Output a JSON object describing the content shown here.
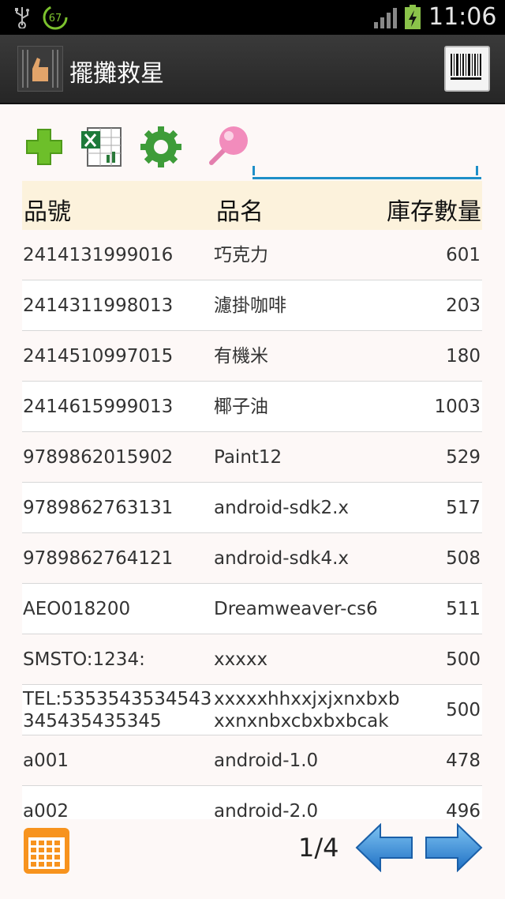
{
  "status": {
    "clock": "11:06",
    "badge": "67"
  },
  "app": {
    "title": "擺攤救星"
  },
  "search": {
    "value": "",
    "placeholder": ""
  },
  "table": {
    "headers": [
      "品號",
      "品名",
      "庫存數量"
    ],
    "rows": [
      {
        "id": "2414131999016",
        "name": "巧克力",
        "qty": "601"
      },
      {
        "id": "2414311998013",
        "name": "濾掛咖啡",
        "qty": "203"
      },
      {
        "id": "2414510997015",
        "name": "有機米",
        "qty": "180"
      },
      {
        "id": "2414615999013",
        "name": "椰子油",
        "qty": "1003"
      },
      {
        "id": "9789862015902",
        "name": "Paint12",
        "qty": "529"
      },
      {
        "id": "9789862763131",
        "name": "android-sdk2.x",
        "qty": "517"
      },
      {
        "id": "9789862764121",
        "name": "android-sdk4.x",
        "qty": "508"
      },
      {
        "id": "AEO018200",
        "name": "Dreamweaver-cs6",
        "qty": "511"
      },
      {
        "id": "SMSTO:1234:",
        "name": "xxxxx",
        "qty": "500"
      },
      {
        "id": "TEL:5353543534543\n345435435345",
        "name": "xxxxxhhxxjxjxnxbxb\nxxnxnbxcbxbxbcak",
        "qty": "500"
      },
      {
        "id": "a001",
        "name": "android-1.0",
        "qty": "478"
      },
      {
        "id": "a002",
        "name": "android-2.0",
        "qty": "496"
      }
    ]
  },
  "pager": {
    "label": "1/4"
  },
  "colors": {
    "accent": "#1e8fc8",
    "header_bg": "#fcf2dc",
    "actionbar": "#2e2e2e"
  }
}
